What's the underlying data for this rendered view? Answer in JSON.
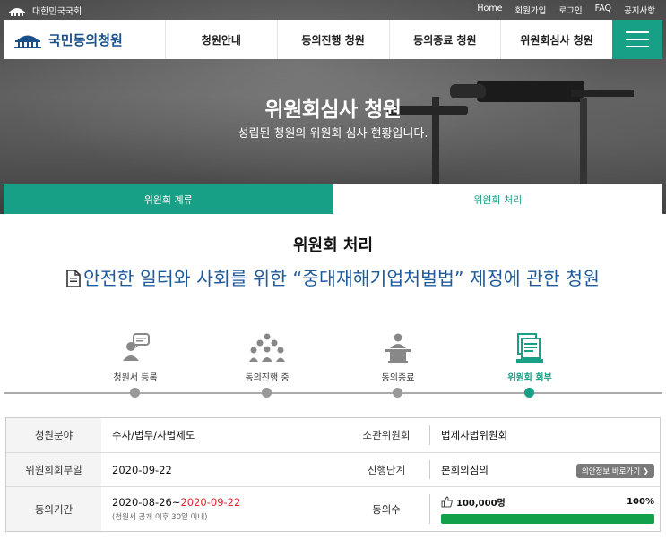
{
  "topbar": {
    "gov_label": "대한민국국회",
    "links": [
      "Home",
      "회원가입",
      "로그인",
      "FAQ",
      "공지사항"
    ]
  },
  "nav": {
    "logo_text": "국민동의청원",
    "items": [
      "청원안내",
      "동의진행 청원",
      "동의종료 청원",
      "위원회심사 청원"
    ]
  },
  "hero": {
    "title": "위원회심사 청원",
    "subtitle": "성립된 청원의 위원회 심사 현황입니다."
  },
  "tabs": [
    "위원회 계류",
    "위원회 처리"
  ],
  "section": {
    "title": "위원회 처리",
    "petition_title": "안전한 일터와 사회를 위한 “중대재해기업처벌법” 제정에 관한 청원"
  },
  "steps": [
    {
      "label": "청원서 등록",
      "icon": "speech-person-icon"
    },
    {
      "label": "동의진행 중",
      "icon": "crowd-icon"
    },
    {
      "label": "동의종료",
      "icon": "podium-icon"
    },
    {
      "label": "위원회 회부",
      "icon": "documents-stack-icon"
    }
  ],
  "info": {
    "field_label": "청원분야",
    "field_value": "수사/법무/사법제도",
    "committee_label": "소관위원회",
    "committee_value": "법제사법위원회",
    "referral_label": "위원회회부일",
    "referral_value": "2020-09-22",
    "stage_label": "진행단계",
    "stage_value": "본회의심의",
    "bill_button": "의안정보 바로가기 ❯",
    "period_label": "동의기간",
    "period_start": "2020-08-26~",
    "period_end": "2020-09-22",
    "period_note": "(청원서 공개 이후 30일 이내)",
    "agree_label": "동의수",
    "agree_count": "100,000명",
    "agree_percent": "100%",
    "agree_ratio": 1.0
  },
  "colors": {
    "accent": "#17a085",
    "title_blue": "#1f5b9c",
    "deadline_red": "#d9272d",
    "progress_green": "#12a04a"
  }
}
